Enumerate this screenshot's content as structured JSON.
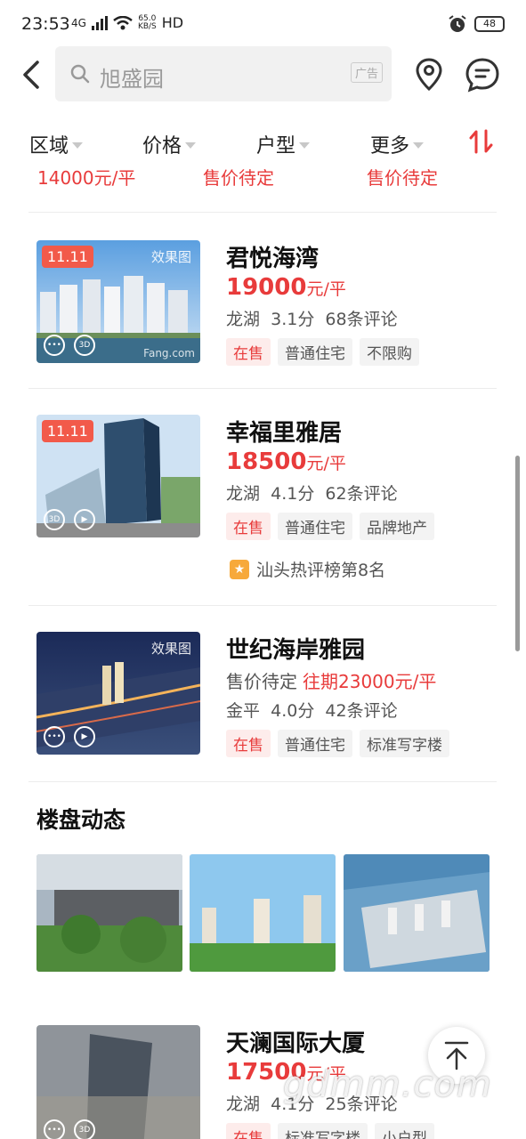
{
  "status_bar": {
    "time": "23:53",
    "network": "4G",
    "speed": "65.0",
    "speed_unit": "KB/S",
    "hd": "HD",
    "battery": "48"
  },
  "search": {
    "placeholder": "旭盛园",
    "ad_label": "广告"
  },
  "filters": [
    {
      "label": "区域"
    },
    {
      "label": "价格"
    },
    {
      "label": "户型"
    },
    {
      "label": "更多"
    }
  ],
  "cut_row": {
    "col1": "14000元/平",
    "col2": "售价待定",
    "col3": "售价待定"
  },
  "listings": [
    {
      "title": "君悦海湾",
      "badge": "11.11",
      "image_tag": "效果图",
      "watermark": "Fang.com",
      "price": "19000",
      "unit": "元/平",
      "district": "龙湖",
      "score": "3.1分",
      "reviews": "68条评论",
      "tags": [
        "在售",
        "普通住宅",
        "不限购"
      ]
    },
    {
      "title": "幸福里雅居",
      "badge": "11.11",
      "price": "18500",
      "unit": "元/平",
      "district": "龙湖",
      "score": "4.1分",
      "reviews": "62条评论",
      "tags": [
        "在售",
        "普通住宅",
        "品牌地产"
      ],
      "rank": "汕头热评榜第8名"
    },
    {
      "title": "世纪海岸雅园",
      "image_tag": "效果图",
      "price_pending": "售价待定",
      "price_history": "往期23000元/平",
      "district": "金平",
      "score": "4.0分",
      "reviews": "42条评论",
      "tags": [
        "在售",
        "普通住宅",
        "标准写字楼"
      ]
    },
    {
      "title": "天澜国际大厦",
      "price": "17500",
      "unit": "元/平",
      "district": "龙湖",
      "score": "4.1分",
      "reviews": "25条评论",
      "tags": [
        "在售",
        "标准写字楼",
        "小户型"
      ]
    }
  ],
  "dynamics": {
    "title": "楼盘动态"
  },
  "watermark": "gdmm.com",
  "colors": {
    "accent": "#e83b3b",
    "badge": "#f25a4a"
  }
}
